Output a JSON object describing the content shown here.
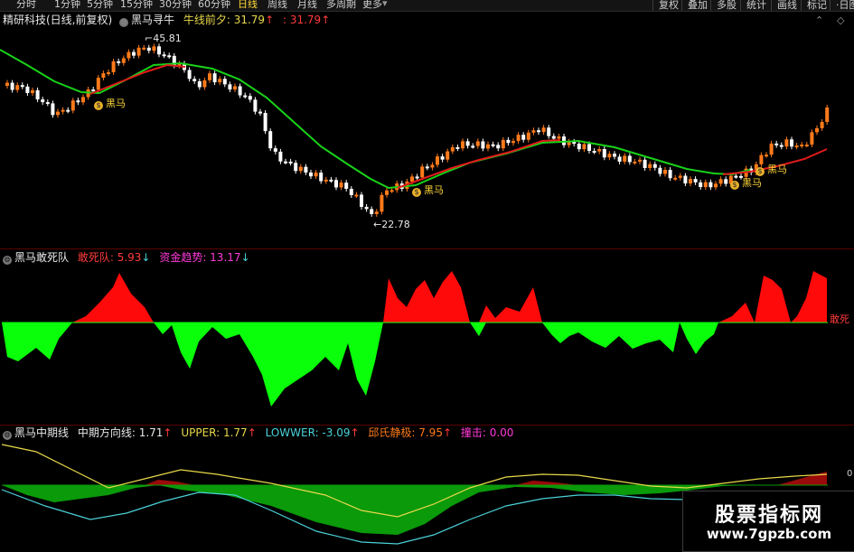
{
  "toolbar": {
    "periods": [
      "分时",
      "1分钟",
      "5分钟",
      "15分钟",
      "30分钟",
      "60分钟",
      "日线",
      "周线",
      "月线",
      "多周期",
      "更多"
    ],
    "active_period": "日线",
    "right_buttons": [
      "复权",
      "叠加",
      "多股",
      "统计",
      "画线",
      "标记",
      "·日图"
    ]
  },
  "main_panel": {
    "title": "精研科技(日线,前复权)",
    "indicator_name": "黑马寻牛",
    "label_bull_eve": "牛线前夕: 31.79",
    "label_colon_value": ": 31.79",
    "up_arrow": "↑",
    "high_label": "45.81",
    "low_label": "22.78",
    "signal_label": "黑马",
    "signal_icon": "$"
  },
  "mid_panel": {
    "indicator_name": "黑马敢死队",
    "label_dare": "敢死队: 5.93",
    "label_fund": "资金趋势: 13.17",
    "down_arrow": "↓",
    "right_label": "敢死"
  },
  "bottom_panel": {
    "indicator_name": "黑马中期线",
    "label_mid": "中期方向线: 1.71",
    "label_upper": "UPPER: 1.77",
    "label_lower": "LOWWER: -3.09",
    "label_qiu": "邱氏静极: 7.95",
    "label_hit": "撞击: 0.00",
    "up_arrow": "↑",
    "right_value": "0"
  },
  "watermark": {
    "line1": "股票指标网",
    "line2": "www.7gpzb.com"
  },
  "colors": {
    "up_candle": "#ff7a1a",
    "down_candle": "#ffffff",
    "green_line": "#19d219",
    "red_line": "#e01a1a",
    "green_area": "#0aff0a",
    "red_area": "#ff0a0a",
    "yellow_line": "#e8d84a",
    "cyan_line": "#4ad1d8"
  }
}
